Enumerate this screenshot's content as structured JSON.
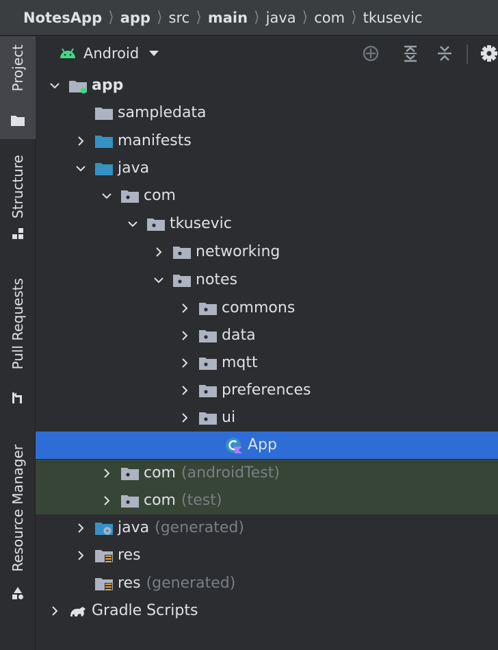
{
  "breadcrumb": {
    "items": [
      {
        "label": "NotesApp",
        "bold": true
      },
      {
        "label": "app",
        "bold": true
      },
      {
        "label": "src",
        "bold": false
      },
      {
        "label": "main",
        "bold": true
      },
      {
        "label": "java",
        "bold": false
      },
      {
        "label": "com",
        "bold": false
      },
      {
        "label": "tkusevic",
        "bold": false
      }
    ]
  },
  "tool_stripe": {
    "project": "Project",
    "structure": "Structure",
    "pull_requests": "Pull Requests",
    "resource_manager": "Resource Manager"
  },
  "toolbar": {
    "view": "Android",
    "icons": [
      "locate-icon",
      "expand-all-icon",
      "collapse-all-icon",
      "gear-icon"
    ]
  },
  "tree": [
    {
      "label": "app",
      "extra": "",
      "icon": "module-folder",
      "chevron": "down",
      "bold": true,
      "style": ""
    },
    {
      "label": "sampledata",
      "extra": "",
      "icon": "folder-gray",
      "chevron": "",
      "bold": false,
      "style": ""
    },
    {
      "label": "manifests",
      "extra": "",
      "icon": "folder-blue",
      "chevron": "right",
      "bold": false,
      "style": ""
    },
    {
      "label": "java",
      "extra": "",
      "icon": "folder-blue",
      "chevron": "down",
      "bold": false,
      "style": ""
    },
    {
      "label": "com",
      "extra": "",
      "icon": "package",
      "chevron": "down",
      "bold": false,
      "style": ""
    },
    {
      "label": "tkusevic",
      "extra": "",
      "icon": "package",
      "chevron": "down",
      "bold": false,
      "style": ""
    },
    {
      "label": "networking",
      "extra": "",
      "icon": "package",
      "chevron": "right",
      "bold": false,
      "style": ""
    },
    {
      "label": "notes",
      "extra": "",
      "icon": "package",
      "chevron": "down",
      "bold": false,
      "style": ""
    },
    {
      "label": "commons",
      "extra": "",
      "icon": "package",
      "chevron": "right",
      "bold": false,
      "style": ""
    },
    {
      "label": "data",
      "extra": "",
      "icon": "package",
      "chevron": "right",
      "bold": false,
      "style": ""
    },
    {
      "label": "mqtt",
      "extra": "",
      "icon": "package",
      "chevron": "right",
      "bold": false,
      "style": ""
    },
    {
      "label": "preferences",
      "extra": "",
      "icon": "package",
      "chevron": "right",
      "bold": false,
      "style": ""
    },
    {
      "label": "ui",
      "extra": "",
      "icon": "package",
      "chevron": "right",
      "bold": false,
      "style": ""
    },
    {
      "label": "App",
      "extra": "",
      "icon": "kotlin-class",
      "chevron": "",
      "bold": false,
      "style": "selected"
    },
    {
      "label": "com",
      "extra": "(androidTest)",
      "icon": "package",
      "chevron": "right",
      "bold": false,
      "style": "test"
    },
    {
      "label": "com",
      "extra": "(test)",
      "icon": "package",
      "chevron": "right",
      "bold": false,
      "style": "test"
    },
    {
      "label": "java",
      "extra": "(generated)",
      "icon": "generated-folder",
      "chevron": "right",
      "bold": false,
      "style": ""
    },
    {
      "label": "res",
      "extra": "",
      "icon": "res-folder",
      "chevron": "right",
      "bold": false,
      "style": ""
    },
    {
      "label": "res",
      "extra": "(generated)",
      "icon": "res-folder",
      "chevron": "",
      "bold": false,
      "style": ""
    },
    {
      "label": "Gradle Scripts",
      "extra": "",
      "icon": "gradle",
      "chevron": "right",
      "bold": false,
      "style": ""
    }
  ],
  "colors": {
    "selection": "#2e6dd6",
    "test_highlight": "#374536",
    "folder_blue": "#3592c4",
    "folder_gray": "#aeb3c2",
    "android_green": "#3ddc84"
  }
}
